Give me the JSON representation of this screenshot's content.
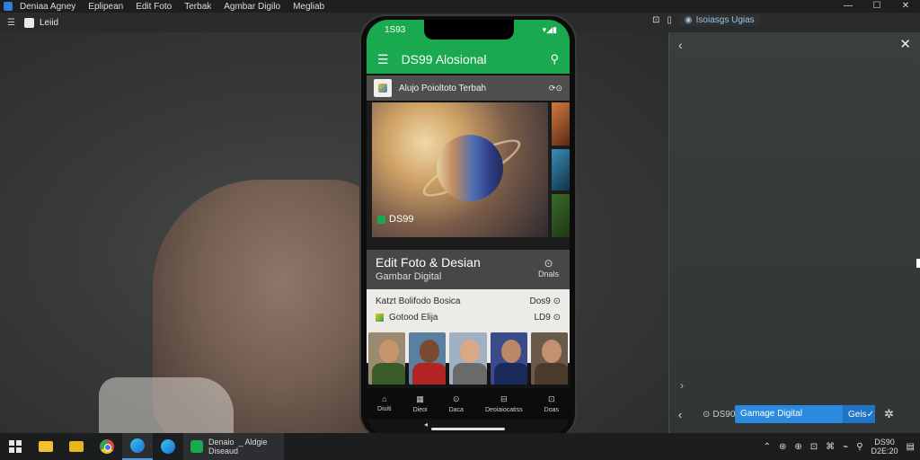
{
  "menubar": {
    "items": [
      "Deniaa Agney",
      "Eplipean",
      "Edit Foto",
      "Terbak",
      "Agmbar Digilo",
      "Megliab"
    ],
    "controls": [
      "—",
      "☐",
      "✕"
    ]
  },
  "toolbar2": {
    "tab_label": "Leiid",
    "right_pill": "Isoiasgs Ugias"
  },
  "phone": {
    "status_time": "1S93",
    "status_icons": "▾◢▮",
    "app_title": "DS99 Alosional",
    "card_header": "Alujo Poioltoto Terbah",
    "hero_badge": "DS99",
    "title": "Edit Foto & Desian",
    "subtitle": "Gambar Digital",
    "title_right": "Dnals",
    "list": [
      {
        "label": "Katzt Bolifodo Bosica",
        "meta": "Dos9 ⊙"
      },
      {
        "label": "Gotood Elija",
        "meta": "LD9 ⊙"
      }
    ],
    "nav": [
      {
        "icon": "⌂",
        "label": "Diuiti"
      },
      {
        "icon": "▦",
        "label": "Dieoi"
      },
      {
        "icon": "⊙",
        "label": "Daca"
      },
      {
        "icon": "⊟",
        "label": "Deoiaiocatiss"
      },
      {
        "icon": "⊡",
        "label": "Doas"
      }
    ],
    "people_colors": [
      "#3b5a2a",
      "#b02424",
      "#6a6a6a",
      "#1a2a5a",
      "#4a3a2a"
    ]
  },
  "right_panel": {
    "id_label": "DS90",
    "input_value": "Gamage Digital",
    "button_label": "Geis"
  },
  "taskbar": {
    "task_title": "Denaio  _ Aldgie\nDiseaud",
    "tray_icons": [
      "⌃",
      "⊛",
      "⊕",
      "⊡",
      "⌘",
      "⌁",
      "⚲"
    ],
    "clock": "DS90\nD2E:20"
  }
}
